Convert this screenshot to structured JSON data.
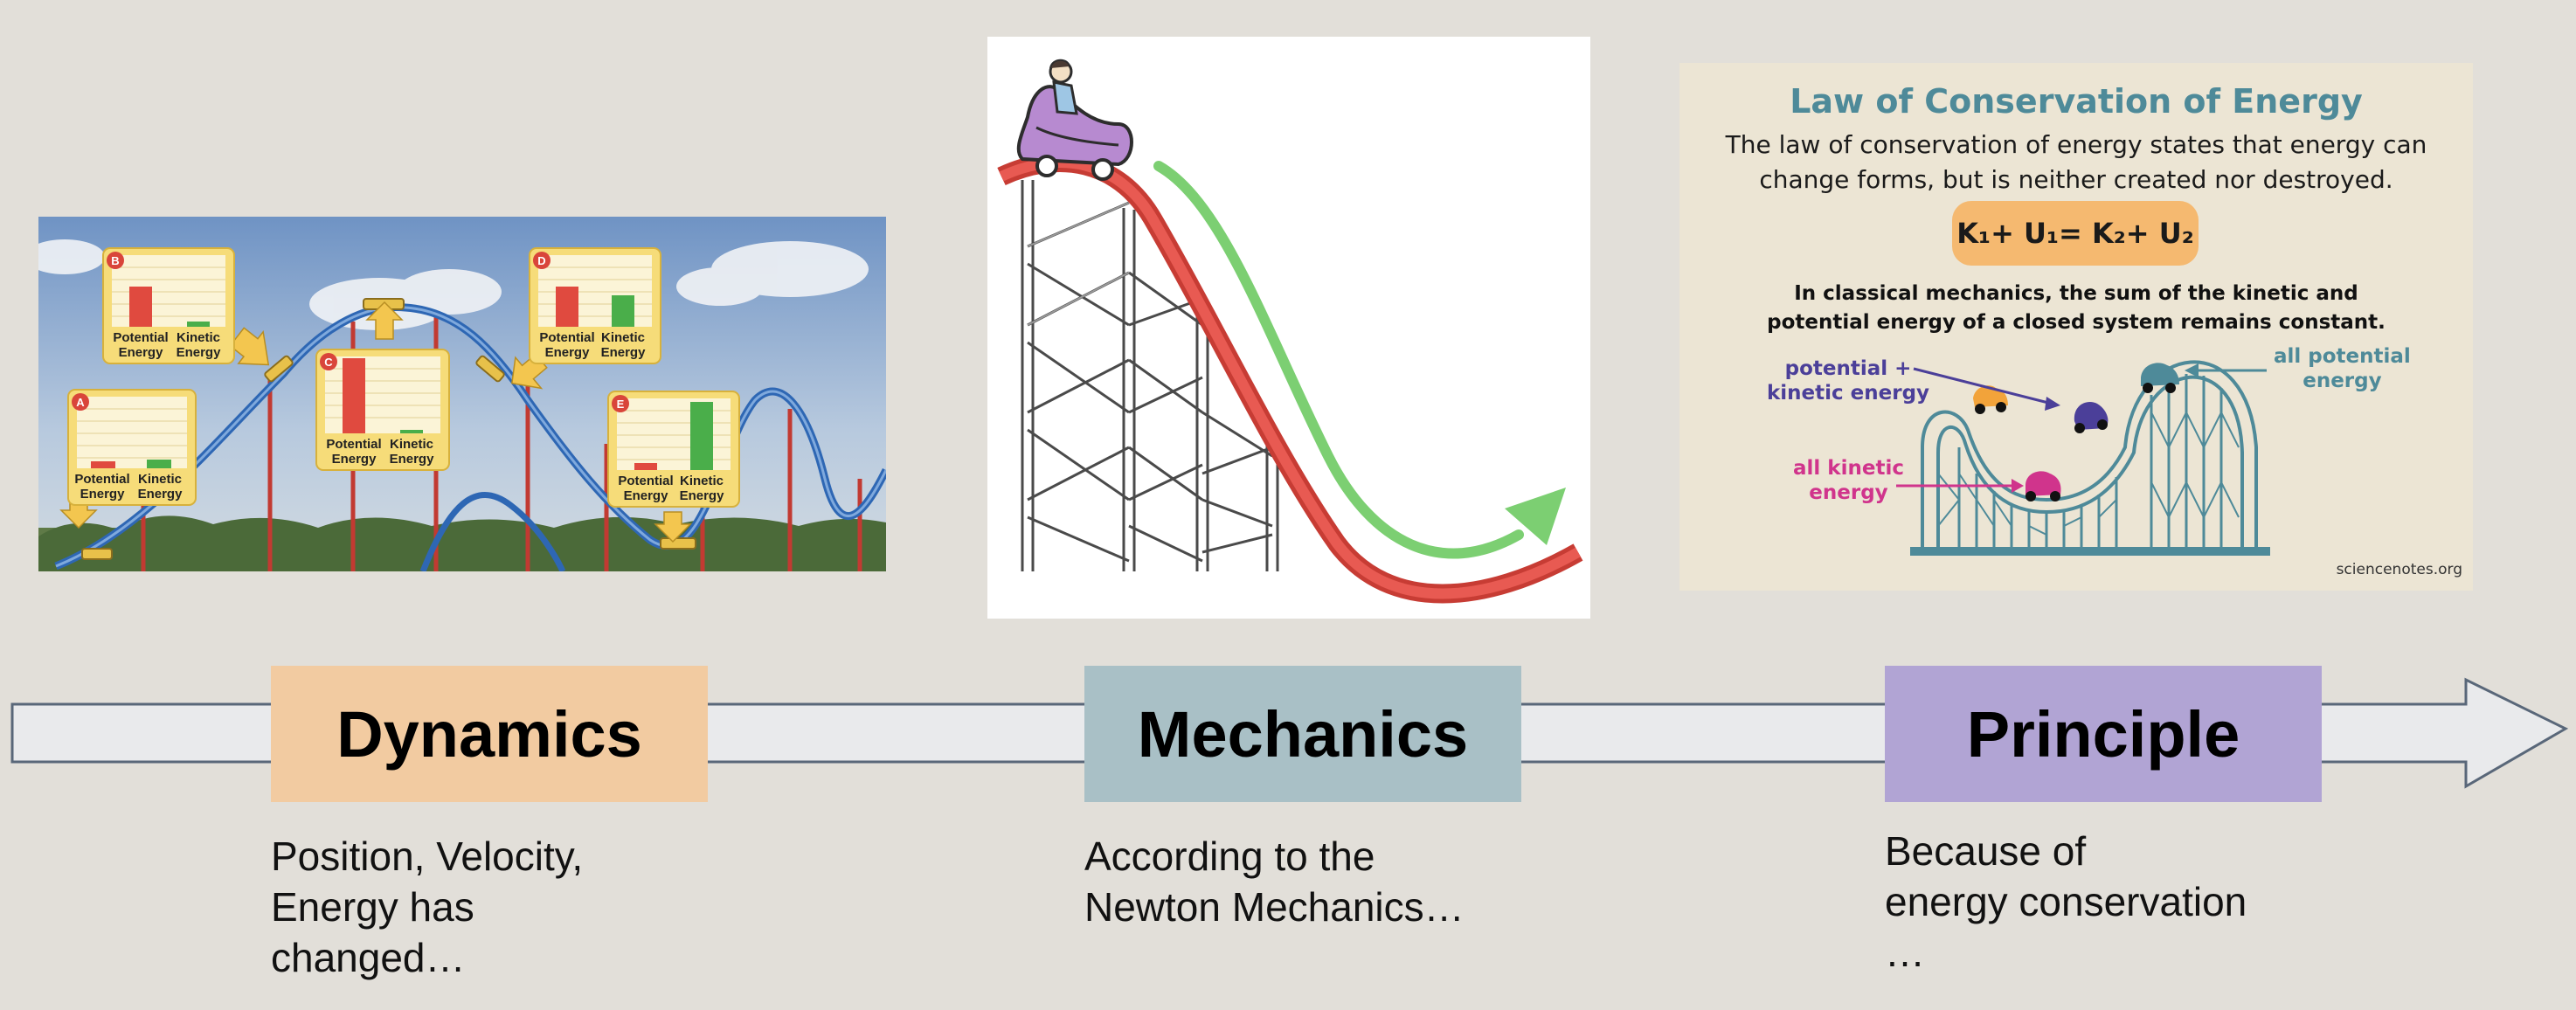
{
  "colors": {
    "background": "#e2dfd9",
    "dynamics": "#f2cba1",
    "mechanics": "#a9c0c6",
    "principle": "#b1a4d4",
    "energy_title": "#4e8a99",
    "formula_bg": "#f5b970",
    "track_red": "#e0534a",
    "arrow_green": "#7ccf72"
  },
  "timeline": {
    "labels": [
      "Dynamics",
      "Mechanics",
      "Principle"
    ],
    "captions": [
      [
        "Position, Velocity,",
        "Energy has",
        "changed…"
      ],
      [
        "According to the",
        "Newton Mechanics…"
      ],
      [
        "Because of",
        "energy conservation",
        "…"
      ]
    ]
  },
  "panel_coaster": {
    "points": [
      "A",
      "B",
      "C",
      "D",
      "E"
    ],
    "potential_label": [
      "Potential",
      "Energy"
    ],
    "kinetic_label": [
      "Kinetic",
      "Energy"
    ]
  },
  "panel_energy": {
    "title": "Law of Conservation of Energy",
    "description": "The law of conservation of energy states that energy can change forms, but is neither created nor destroyed.",
    "formula": "K₁+ U₁= K₂+ U₂",
    "classical": "In classical mechanics, the sum of the kinetic and potential energy of a closed system remains constant.",
    "label_mixed": [
      "potential +",
      "kinetic energy"
    ],
    "label_kinetic": [
      "all kinetic",
      "energy"
    ],
    "label_potential": [
      "all potential",
      "energy"
    ],
    "label_mixed_color": "#4b3f99",
    "label_kinetic_color": "#d0348c",
    "label_potential_color": "#4e8a99",
    "source": "sciencenotes.org"
  }
}
